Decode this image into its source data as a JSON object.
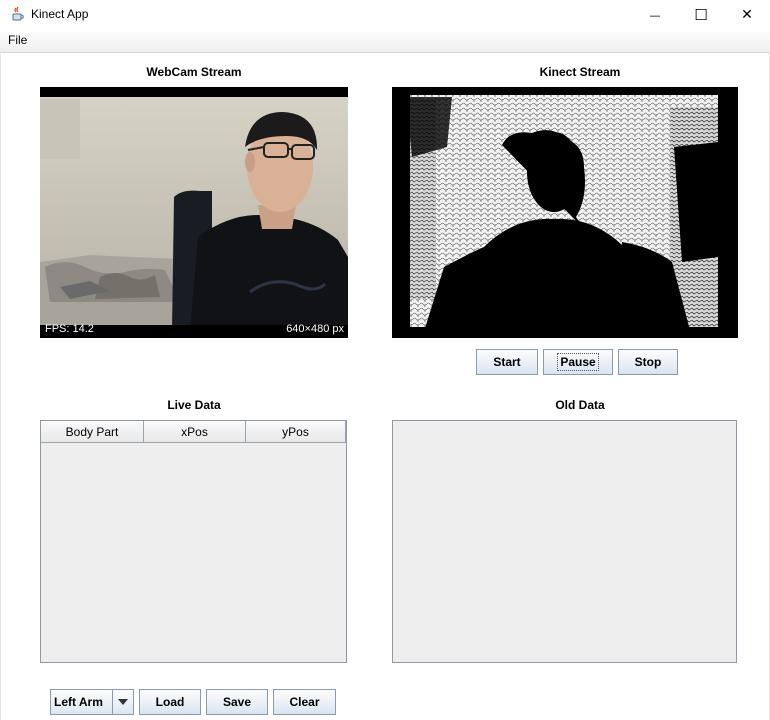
{
  "window": {
    "title": "Kinect App",
    "minimize_glyph": "—",
    "maximize_glyph": "☐",
    "close_glyph": "✕"
  },
  "menu": {
    "file_label": "File"
  },
  "webcam": {
    "label": "WebCam Stream",
    "fps_text": "FPS: 14.2",
    "resolution_text": "640×480 px"
  },
  "kinect": {
    "label": "Kinect Stream"
  },
  "controls": {
    "start_label": "Start",
    "pause_label": "Pause",
    "stop_label": "Stop"
  },
  "live_data": {
    "label": "Live Data",
    "columns": [
      "Body Part",
      "xPos",
      "yPos"
    ]
  },
  "old_data": {
    "label": "Old Data"
  },
  "bottom": {
    "combo_value": "Left Arm",
    "load_label": "Load",
    "save_label": "Save",
    "clear_label": "Clear"
  },
  "icons": {
    "app": "java-cup-icon",
    "combo_arrow": "triangle-down-icon"
  },
  "colors": {
    "button_gradient_bottom": "#d9e4f1",
    "panel_bg": "#eeeeee",
    "border": "#8f9aa8"
  }
}
